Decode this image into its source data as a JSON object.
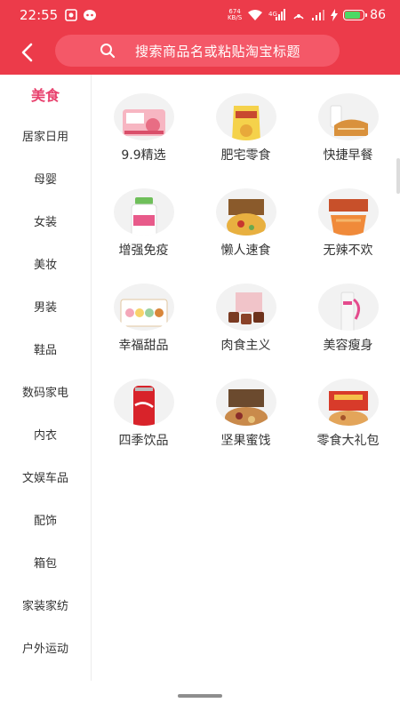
{
  "status_bar": {
    "time": "22:55",
    "net_speed_value": "674",
    "net_speed_unit": "KB/S",
    "signal_label": "4G",
    "battery_percent": "86",
    "battery_level": 0.86,
    "accent_color": "#ec3b4a"
  },
  "header": {
    "back_icon": "chevron-left-icon",
    "search_icon": "search-icon",
    "search_placeholder": "搜索商品名或粘贴淘宝标题"
  },
  "sidebar": {
    "items": [
      {
        "label": "美食",
        "active": true
      },
      {
        "label": "居家日用",
        "active": false
      },
      {
        "label": "母婴",
        "active": false
      },
      {
        "label": "女装",
        "active": false
      },
      {
        "label": "美妆",
        "active": false
      },
      {
        "label": "男装",
        "active": false
      },
      {
        "label": "鞋品",
        "active": false
      },
      {
        "label": "数码家电",
        "active": false
      },
      {
        "label": "内衣",
        "active": false
      },
      {
        "label": "文娱车品",
        "active": false
      },
      {
        "label": "配饰",
        "active": false
      },
      {
        "label": "箱包",
        "active": false
      },
      {
        "label": "家装家纺",
        "active": false
      },
      {
        "label": "户外运动",
        "active": false
      }
    ],
    "active_color": "#e8426e"
  },
  "categories": [
    {
      "label": "9.9精选",
      "image": "snack-pack-image"
    },
    {
      "label": "肥宅零食",
      "image": "chips-bag-image"
    },
    {
      "label": "快捷早餐",
      "image": "bread-milk-image"
    },
    {
      "label": "增强免疫",
      "image": "supplement-bottle-image"
    },
    {
      "label": "懒人速食",
      "image": "instant-noodle-image"
    },
    {
      "label": "无辣不欢",
      "image": "spicy-snack-image"
    },
    {
      "label": "幸福甜品",
      "image": "macaron-box-image"
    },
    {
      "label": "肉食主义",
      "image": "meat-snack-image"
    },
    {
      "label": "美容瘦身",
      "image": "beauty-product-image"
    },
    {
      "label": "四季饮品",
      "image": "cola-can-image"
    },
    {
      "label": "坚果蜜饯",
      "image": "nut-gift-box-image"
    },
    {
      "label": "零食大礼包",
      "image": "snack-gift-box-image"
    }
  ]
}
